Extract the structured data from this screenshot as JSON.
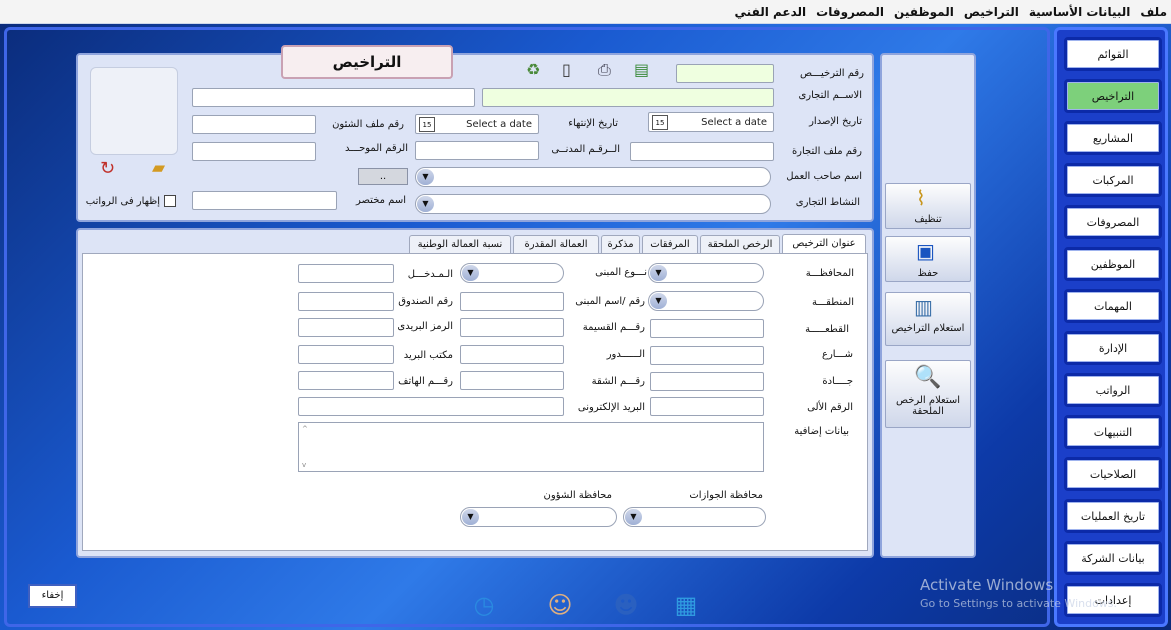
{
  "menu": [
    "ملف",
    "البيانات الأساسية",
    "التراخيص",
    "الموظفين",
    "المصروفات",
    "الدعم الفني"
  ],
  "nav": [
    "القوائم",
    "التراخيص",
    "المشاريع",
    "المركبات",
    "المصروفات",
    "الموظفين",
    "المهمات",
    "الإدارة",
    "الرواتب",
    "التنبيهات",
    "الصلاحيات",
    "تاريخ العمليات",
    "بيانات الشركة",
    "إعدادات"
  ],
  "nav_active": 1,
  "header": {
    "title": "التراخيص",
    "labels": {
      "license_no": "رقم الترخيـــص",
      "trade_name": "الاســم التجارى",
      "issue_date": "تاريخ الإصدار",
      "end_date": "تاريخ الإنتهاء",
      "affairs_file": "رقم ملف الشئون",
      "trade_file": "رقم ملف التجارة",
      "civil_no": "الــرقـم المدنــى",
      "unified_no": "الرقم الموحـــد",
      "employer": "اسم صاحب العمل",
      "activity": "النشاط التجارى",
      "short_name": "اسم مختصر",
      "show_salaries": "إظهار فى الرواتب"
    },
    "date_placeholder": "Select a date",
    "browse_label": ".."
  },
  "tabs": [
    "عنوان الترخيص",
    "الرخص الملحقة",
    "المرفقات",
    "مذكرة",
    "العمالة المقدرة",
    "نسبة العمالة الوطنية"
  ],
  "address": {
    "labels": {
      "governorate": "المحافظـــة",
      "building_type": "نـــوع المبنى",
      "entrance": "الـمـدخـــل",
      "region": "المنطقـــة",
      "building_no": "رقم /اسم المبنى",
      "pobox": "رقم الصندوق",
      "block": "القطعـــــة",
      "parcel": "رقـــم القسيمة",
      "postal": "الرمز البريدى",
      "street": "شـــارع",
      "floor": "الــــــدور",
      "post_office": "مكتب البريد",
      "avenue": "جــــادة",
      "apartment": "رقـــم الشقة",
      "phone": "رقـــم الهاتف",
      "auto_no": "الرقم الألى",
      "email": "البريد الإلكترونى",
      "extra": "بيانات إضافية",
      "passport_gov": "محافظة الجوازات",
      "affairs_gov": "محافظة الشؤون"
    }
  },
  "side_actions": [
    "تنظيف",
    "حفظ",
    "استعلام التراخيص",
    "استعلام الرخص الملحقة"
  ],
  "hide_button": "إخفاء",
  "watermark": {
    "line1": "Activate Windows",
    "line2": "Go to Settings to activate Windows."
  }
}
